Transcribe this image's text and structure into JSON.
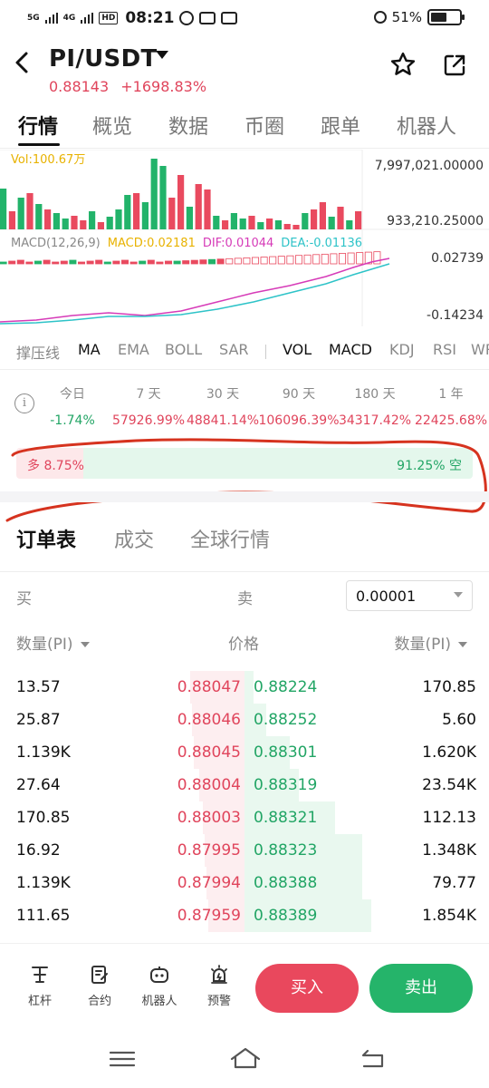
{
  "status_bar": {
    "net1": "5G",
    "net2": "4G",
    "hd": "HD",
    "time": "08:21",
    "battery": "51%"
  },
  "header": {
    "pair": "PI/USDT",
    "price": "0.88143",
    "change": "+1698.83%"
  },
  "tabs": [
    "行情",
    "概览",
    "数据",
    "币圈",
    "跟单",
    "机器人"
  ],
  "chart": {
    "vol_label": "Vol:100.67万",
    "vol_axis_top": "7,997,021.00000",
    "vol_axis_bottom": "933,210.25000",
    "macd_title": "MACD(12,26,9)",
    "macd_value": "MACD:0.02181",
    "dif_value": "DIF:0.01044",
    "dea_value": "DEA:-0.01136",
    "macd_axis_top": "0.02739",
    "macd_axis_bottom": "-0.14234"
  },
  "indicators": [
    "撑压线",
    "MA",
    "EMA",
    "BOLL",
    "SAR",
    "VOL",
    "MACD",
    "KDJ",
    "RSI",
    "WR"
  ],
  "performance": [
    {
      "label": "今日",
      "value": "-1.74%",
      "color": "#22a565"
    },
    {
      "label": "7 天",
      "value": "57926.99%",
      "color": "#e0455c"
    },
    {
      "label": "30 天",
      "value": "48841.14%",
      "color": "#e0455c"
    },
    {
      "label": "90 天",
      "value": "106096.39%",
      "color": "#e0455c"
    },
    {
      "label": "180 天",
      "value": "34317.42%",
      "color": "#e0455c"
    },
    {
      "label": "1 年",
      "value": "22425.68%",
      "color": "#e0455c"
    }
  ],
  "long_short": {
    "long_label": "多 8.75%",
    "short_label": "91.25% 空",
    "long_pct": 8.75,
    "short_pct": 91.25
  },
  "orderbook_tabs": [
    "订单表",
    "成交",
    "全球行情"
  ],
  "orderbook": {
    "buy_label": "买",
    "sell_label": "卖",
    "precision": "0.00001",
    "qty_head_left": "数量(PI)",
    "price_head": "价格",
    "qty_head_right": "数量(PI)",
    "rows": [
      {
        "bid_qty": "13.57",
        "bid_price": "0.88047",
        "ask_price": "0.88224",
        "ask_qty": "170.85"
      },
      {
        "bid_qty": "25.87",
        "bid_price": "0.88046",
        "ask_price": "0.88252",
        "ask_qty": "5.60"
      },
      {
        "bid_qty": "1.139K",
        "bid_price": "0.88045",
        "ask_price": "0.88301",
        "ask_qty": "1.620K"
      },
      {
        "bid_qty": "27.64",
        "bid_price": "0.88004",
        "ask_price": "0.88319",
        "ask_qty": "23.54K"
      },
      {
        "bid_qty": "170.85",
        "bid_price": "0.88003",
        "ask_price": "0.88321",
        "ask_qty": "112.13"
      },
      {
        "bid_qty": "16.92",
        "bid_price": "0.87995",
        "ask_price": "0.88323",
        "ask_qty": "1.348K"
      },
      {
        "bid_qty": "1.139K",
        "bid_price": "0.87994",
        "ask_price": "0.88388",
        "ask_qty": "79.77"
      },
      {
        "bid_qty": "111.65",
        "bid_price": "0.87959",
        "ask_price": "0.88389",
        "ask_qty": "1.854K"
      }
    ]
  },
  "actions": [
    {
      "label": "杠杆",
      "icon": "leverage-icon"
    },
    {
      "label": "合约",
      "icon": "contract-icon"
    },
    {
      "label": "机器人",
      "icon": "robot-icon"
    },
    {
      "label": "预警",
      "icon": "alarm-icon"
    }
  ],
  "buttons": {
    "buy": "买入",
    "sell": "卖出"
  },
  "colors": {
    "red": "#e0455c",
    "green": "#22a565",
    "buy_button": "#e9485d",
    "sell_button": "#25b46a"
  }
}
